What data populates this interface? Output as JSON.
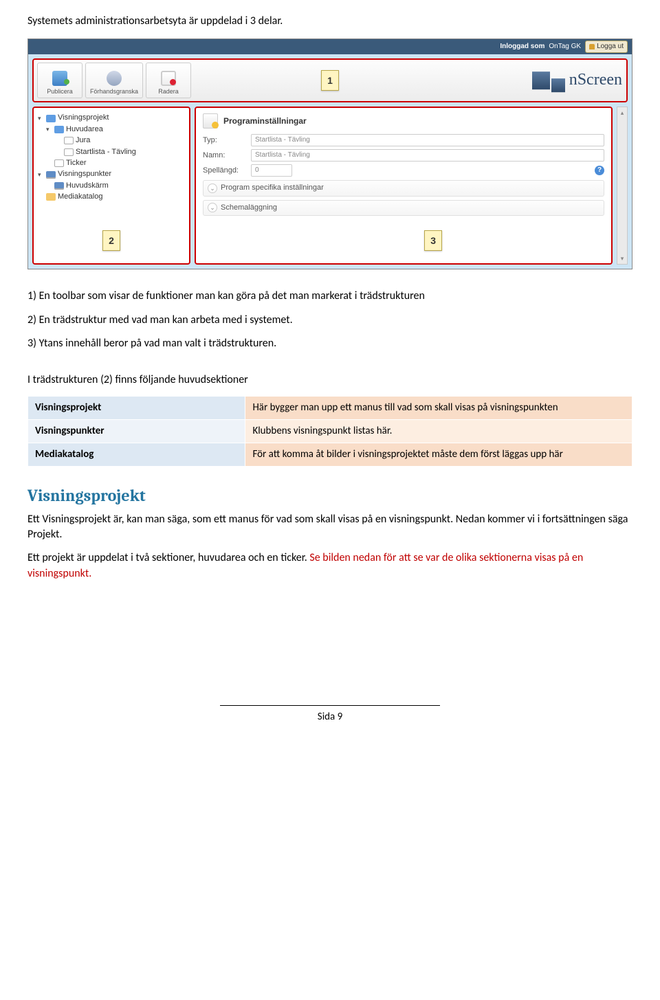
{
  "intro_text": "Systemets administrationsarbetsyta är uppdelad i 3 delar.",
  "screenshot": {
    "status": {
      "logged_in_label": "Inloggad som",
      "user": "OnTag GK",
      "logout": "Logga ut"
    },
    "toolbar": {
      "publish": "Publicera",
      "preview": "Förhandsgranska",
      "delete": "Radera",
      "logo": "nScreen",
      "callout": "1"
    },
    "tree": {
      "items": [
        {
          "label": "Visningsprojekt",
          "level": 0,
          "icon": "book",
          "arrow": "▾"
        },
        {
          "label": "Huvudarea",
          "level": 1,
          "icon": "book",
          "arrow": "▾"
        },
        {
          "label": "Jura",
          "level": 2,
          "icon": "page",
          "arrow": ""
        },
        {
          "label": "Startlista - Tävling",
          "level": 2,
          "icon": "page",
          "arrow": ""
        },
        {
          "label": "Ticker",
          "level": 1,
          "icon": "page",
          "arrow": ""
        },
        {
          "label": "Visningspunkter",
          "level": 0,
          "icon": "monitor",
          "arrow": "▾"
        },
        {
          "label": "Huvudskärm",
          "level": 1,
          "icon": "monitor",
          "arrow": ""
        },
        {
          "label": "Mediakatalog",
          "level": 0,
          "icon": "folder",
          "arrow": ""
        }
      ],
      "callout": "2"
    },
    "content": {
      "title": "Programinställningar",
      "fields": {
        "typ_label": "Typ:",
        "typ_value": "Startlista - Tävling",
        "namn_label": "Namn:",
        "namn_value": "Startlista - Tävling",
        "spel_label": "Spellängd:",
        "spel_value": "0"
      },
      "sections": {
        "specific": "Program specifika inställningar",
        "schema": "Schemaläggning"
      },
      "callout": "3"
    }
  },
  "list": {
    "item1": "1) En toolbar som visar de funktioner man kan göra på det man markerat i trädstrukturen",
    "item2": "2) En trädstruktur med vad man kan arbeta med i systemet.",
    "item3": "3) Ytans innehåll beror på vad man valt i trädstrukturen."
  },
  "tree_sections_intro": "I trädstrukturen (2) finns följande huvudsektioner",
  "table": {
    "r1c1": "Visningsprojekt",
    "r1c2": "Här bygger man upp ett manus till vad som skall visas på visningspunkten",
    "r2c1": "Visningspunkter",
    "r2c2": "Klubbens visningspunkt listas här.",
    "r3c1": "Mediakatalog",
    "r3c2": "För att komma åt bilder i visningsprojektet måste dem först läggas upp här"
  },
  "section": {
    "heading": "Visningsprojekt",
    "p1": "Ett Visningsprojekt är, kan man säga, som ett manus för vad som skall visas på en visningspunkt. Nedan kommer vi i fortsättningen säga Projekt.",
    "p2_a": "Ett projekt är uppdelat i två sektioner, huvudarea och en ticker.",
    "p2_b": "  Se bilden nedan för att se var de olika sektionerna visas på en visningspunkt."
  },
  "page_number": "Sida 9"
}
